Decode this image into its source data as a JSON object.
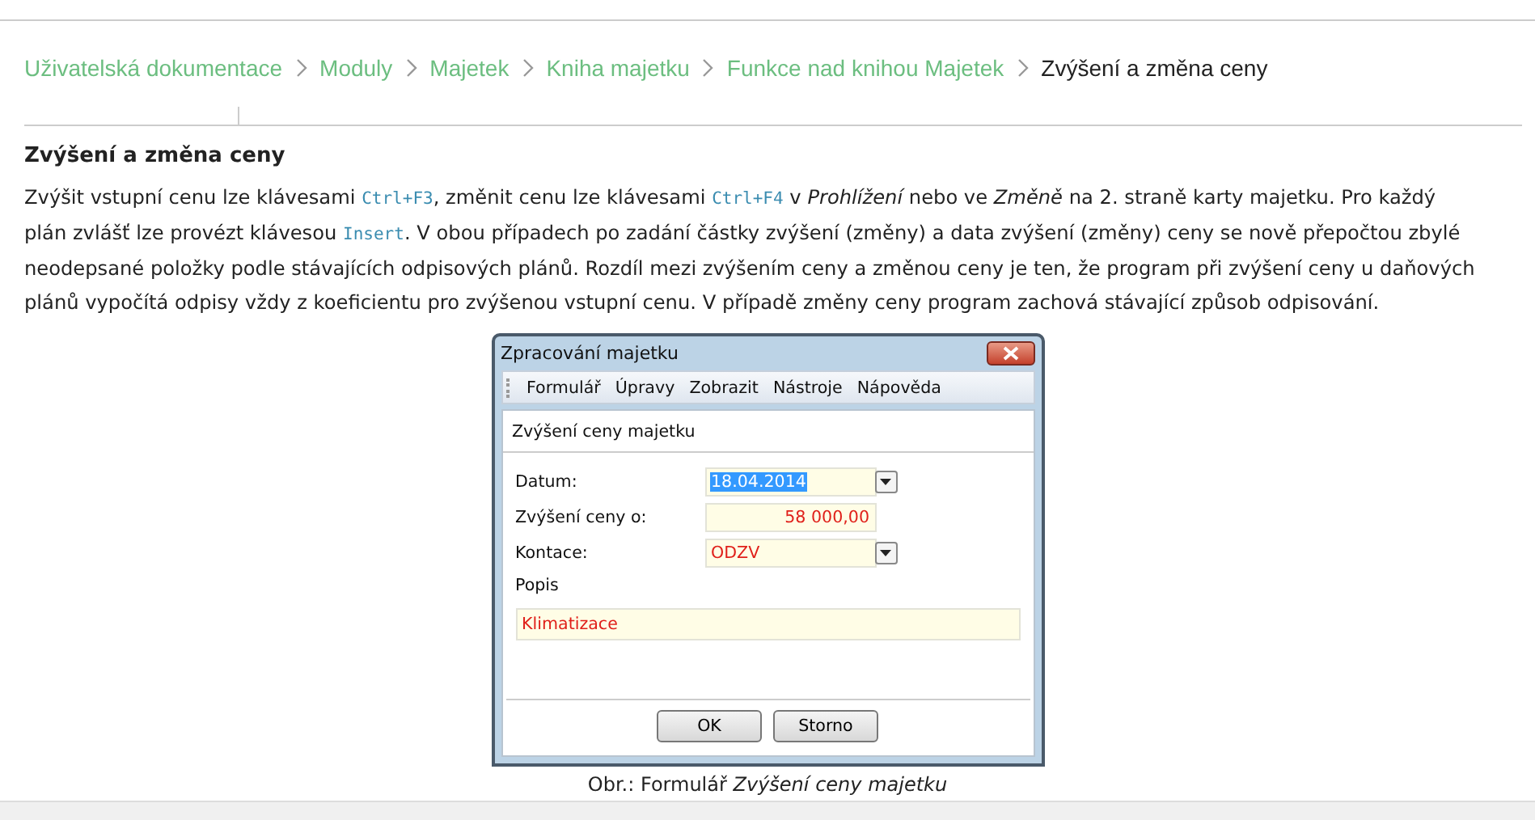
{
  "breadcrumb": [
    {
      "label": "Uživatelská dokumentace",
      "current": false
    },
    {
      "label": "Moduly",
      "current": false
    },
    {
      "label": "Majetek",
      "current": false
    },
    {
      "label": "Kniha majetku",
      "current": false
    },
    {
      "label": "Funkce nad knihou Majetek",
      "current": false
    },
    {
      "label": "Zvýšení a změna ceny",
      "current": true
    }
  ],
  "heading": "Zvýšení a změna ceny",
  "paragraph": [
    {
      "kind": "text",
      "text": "Zvýšit vstupní cenu lze klávesami "
    },
    {
      "kind": "code",
      "text": "Ctrl+F3"
    },
    {
      "kind": "text",
      "text": ", změnit cenu lze klávesami "
    },
    {
      "kind": "code",
      "text": "Ctrl+F4"
    },
    {
      "kind": "text",
      "text": " v *Prohlížení* nebo ve *Změně* na 2. straně karty majetku. Pro každý plán zvlášť lze provézt klávesou "
    },
    {
      "kind": "code",
      "text": "Insert"
    },
    {
      "kind": "text",
      "text": ". V obou případech po zadání částky zvýšení (změny) a data zvýšení (změny) ceny se nově přepočtou zbylé neodepsané položky podle stávajících odpisových plánů. Rozdíl mezi zvýšením ceny a změnou ceny je ten, že program při zvýšení ceny u daňových plánů vypočítá odpisy vždy z koeficientu pro zvýšenou vstupní cenu. V případě změny ceny program zachová stávající způsob odpisování."
    }
  ],
  "dialog": {
    "title": "Zpracování majetku",
    "menu": [
      "Formulář",
      "Úpravy",
      "Zobrazit",
      "Nástroje",
      "Nápověda"
    ],
    "section_title": "Zvýšení ceny majetku",
    "fields": [
      {
        "label": "Datum:",
        "value": "18.04.2014",
        "kind": "dropdown",
        "selected": true
      },
      {
        "label": "Zvýšení ceny o:",
        "value": "58 000,00",
        "kind": "amount",
        "selected": false
      },
      {
        "label": "Kontace:",
        "value": "ODZV",
        "kind": "dropdown",
        "selected": false
      }
    ],
    "popis_label": "Popis",
    "popis_value": "Klimatizace",
    "buttons": [
      "OK",
      "Storno"
    ]
  },
  "caption": "Obr.: Formulář *Zvýšení ceny majetku*"
}
